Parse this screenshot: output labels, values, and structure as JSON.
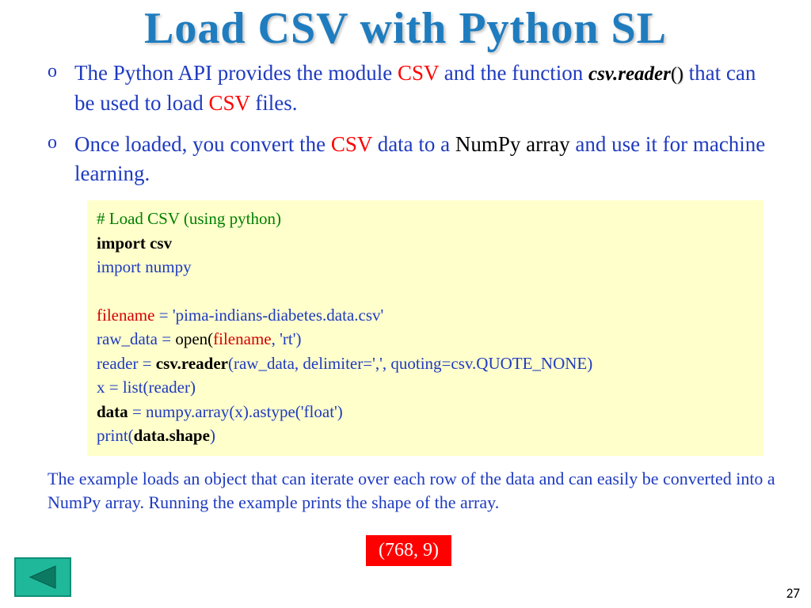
{
  "title": "Load CSV with Python SL",
  "bullets": {
    "b1": {
      "p1": "The Python API provides the module ",
      "csv": "CSV",
      "p2": " and the function ",
      "fn": "csv.reader",
      "parens": "()",
      "p3": " that can be used to load ",
      "csv2": "CSV",
      "p4": " files."
    },
    "b2": {
      "p1": "Once loaded, you convert the ",
      "csv": "CSV",
      "p2": " data to a ",
      "np": "NumPy array",
      "p3": " and use it for machine learning."
    }
  },
  "code": {
    "l1": "# Load CSV (using python)",
    "l2a": "import csv",
    "l3": "import numpy",
    "l5_fn": "filename",
    "l5_eq": " = ",
    "l5_val": "'pima-indians-diabetes.data.csv'",
    "l6_rd": "raw_data = ",
    "l6_open": "open(",
    "l6_fn": "filename",
    "l6_rest": ", 'rt')",
    "l7_rd": "reader = ",
    "l7_csvr": "csv.reader",
    "l7_rest": "(raw_data, delimiter=',', quoting=csv.QUOTE_NONE)",
    "l8": "x = list(reader)",
    "l9_data": "data",
    "l9_rest": " = numpy.array(x).astype('float')",
    "l10_print": "print(",
    "l10_ds": "data.shape",
    "l10_close": ")"
  },
  "caption": "The example loads an object that can iterate over each row of the data and can easily be converted into a NumPy array. Running the example prints the shape of the array.",
  "output": "(768, 9)",
  "page_number": "27"
}
